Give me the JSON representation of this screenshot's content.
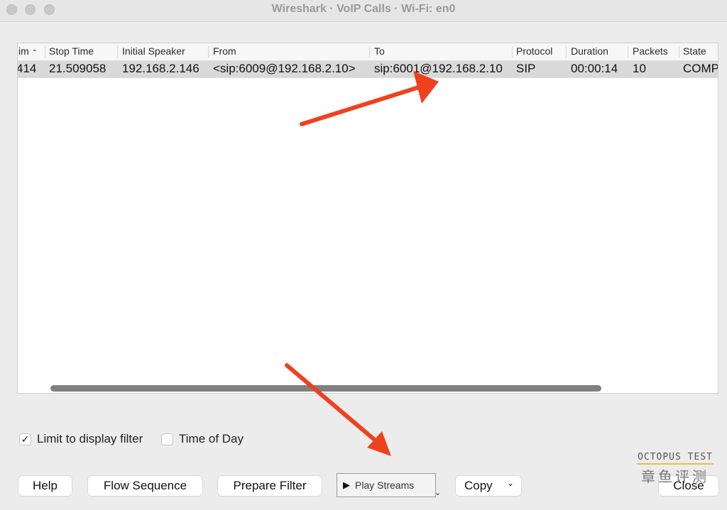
{
  "window": {
    "title": "Wireshark · VoIP Calls · Wi-Fi: en0"
  },
  "table": {
    "columns": [
      {
        "label": "Start Time",
        "visible_label": "im",
        "sort": "ascending"
      },
      {
        "label": "Stop Time"
      },
      {
        "label": "Initial Speaker"
      },
      {
        "label": "From"
      },
      {
        "label": "To"
      },
      {
        "label": "Protocol"
      },
      {
        "label": "Duration"
      },
      {
        "label": "Packets"
      },
      {
        "label": "State"
      }
    ],
    "rows": [
      {
        "start_time": "414",
        "stop_time": "21.509058",
        "initial_speaker": "192.168.2.146",
        "from": "<sip:6009@192.168.2.10>",
        "to": "sip:6001@192.168.2.10",
        "protocol": "SIP",
        "duration": "00:00:14",
        "packets": "10",
        "state": "COMP"
      }
    ],
    "sort_icon": "chevron-up"
  },
  "options": {
    "limit_to_display_filter": {
      "label": "Limit to display filter",
      "checked": true
    },
    "time_of_day": {
      "label": "Time of Day",
      "checked": false
    }
  },
  "buttons": {
    "help": "Help",
    "flow_sequence": "Flow Sequence",
    "prepare_filter": "Prepare Filter",
    "play_streams": "Play Streams",
    "copy": "Copy",
    "close": "Close"
  },
  "annotations": {
    "arrow_color": "#f0411f"
  },
  "watermark": {
    "en": "OCTOPUS TEST",
    "zh": "章鱼评测"
  }
}
